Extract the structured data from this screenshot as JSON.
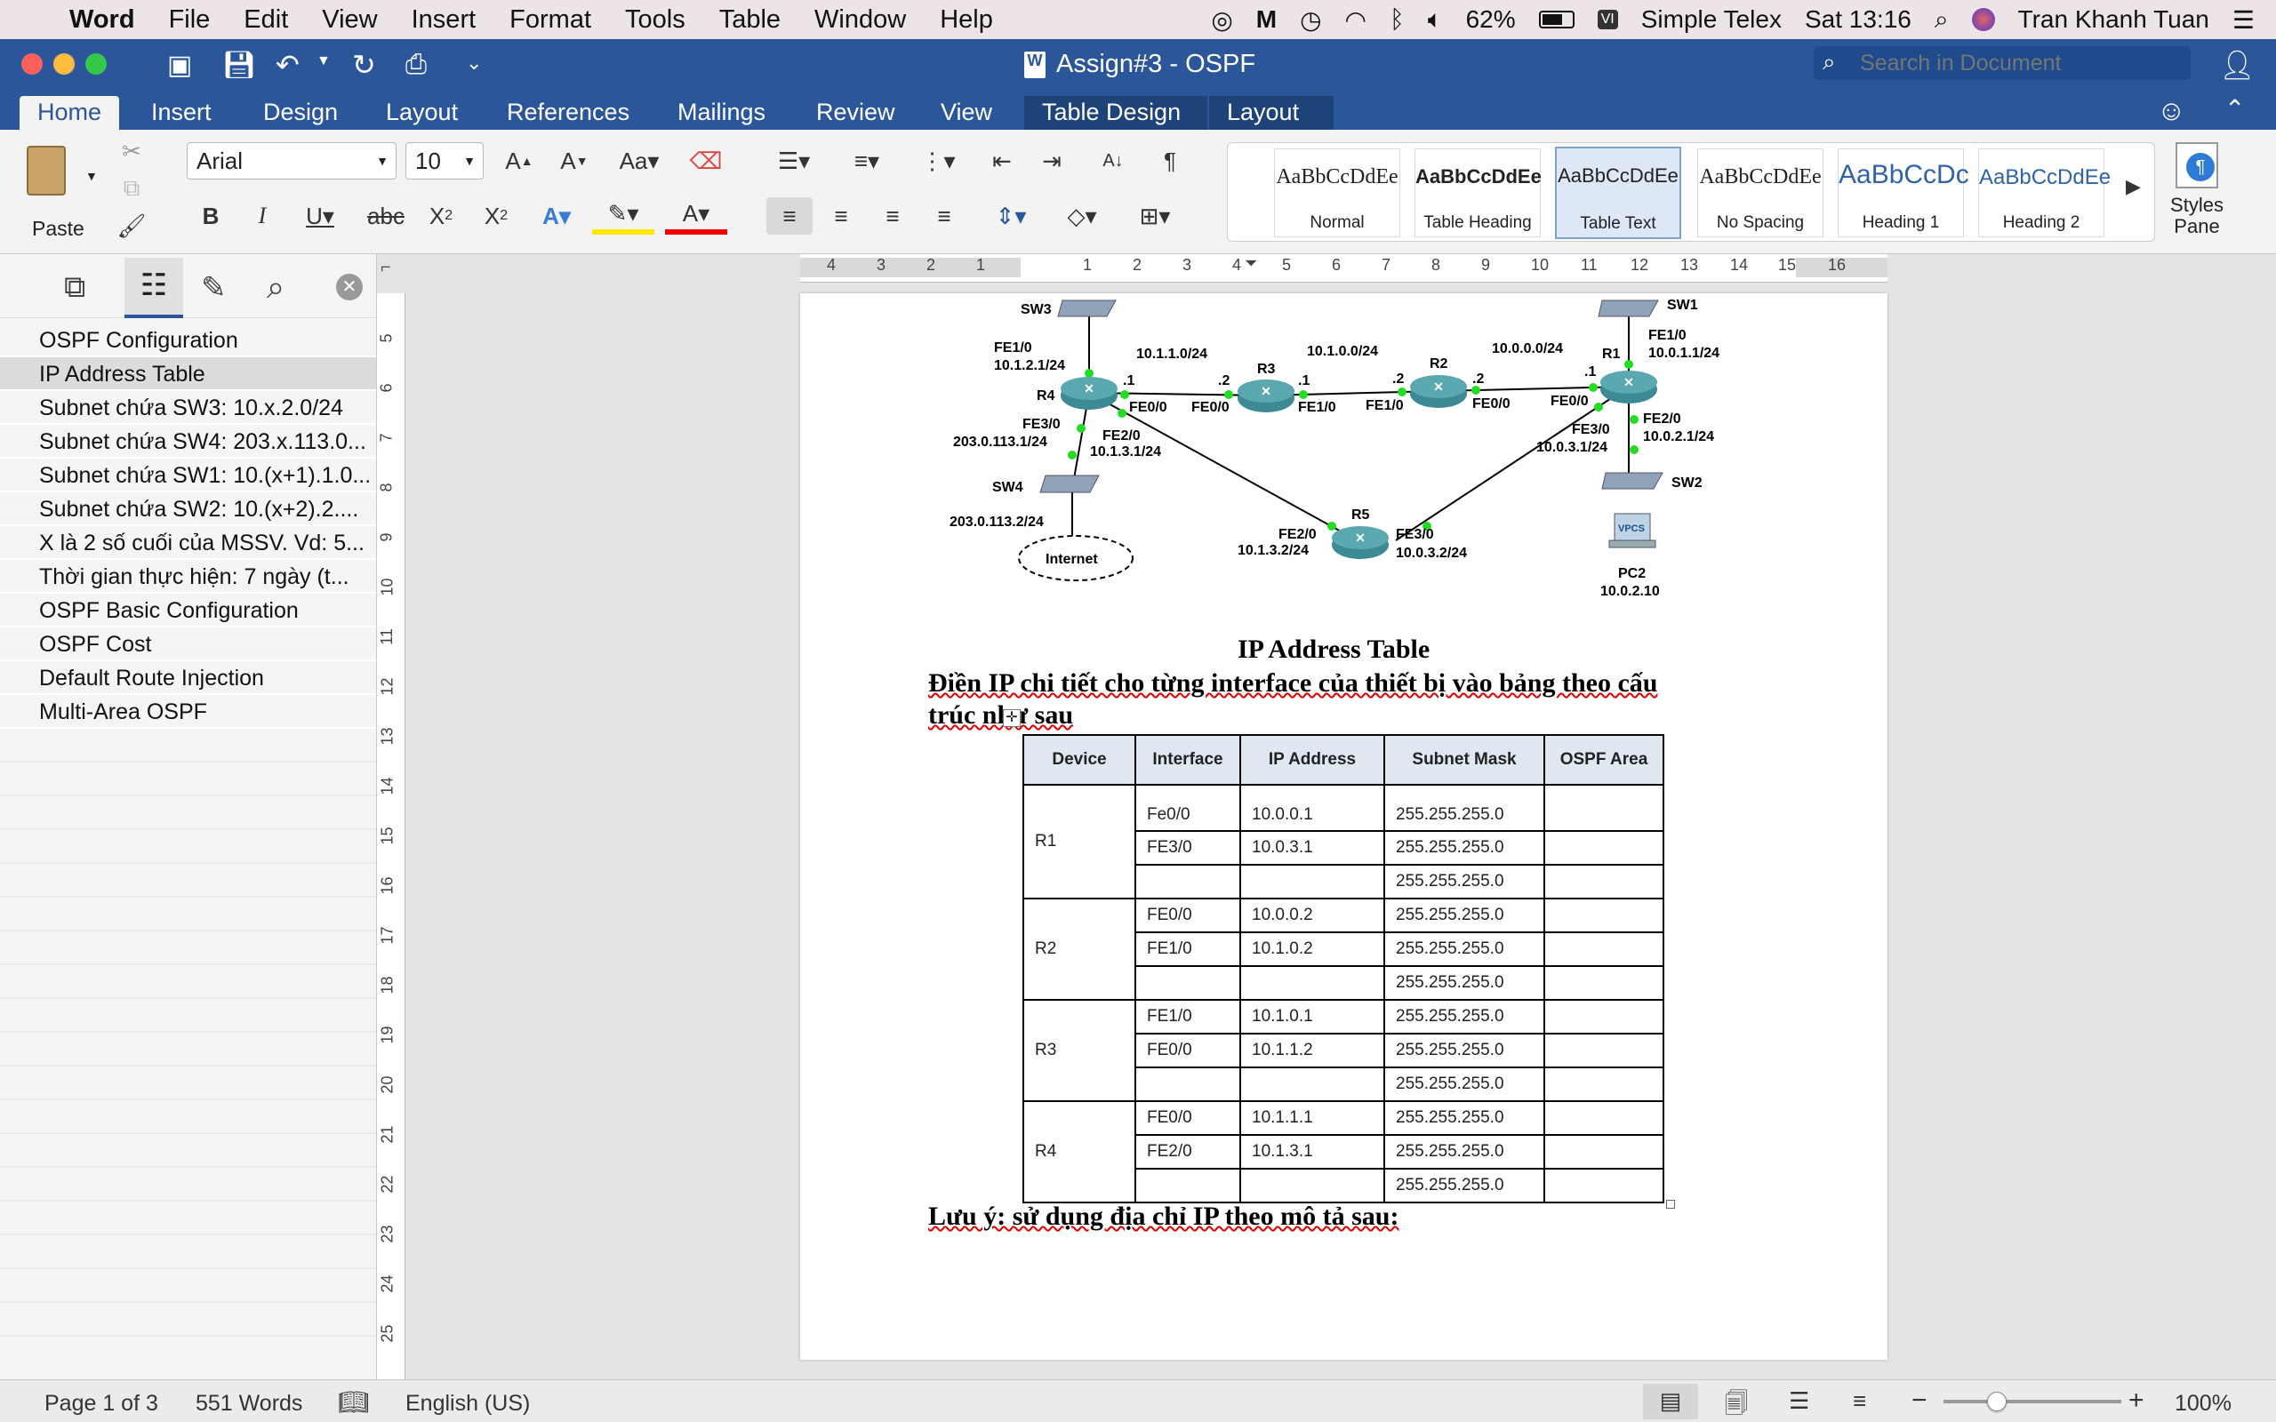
{
  "menubar": {
    "app": "Word",
    "items": [
      "File",
      "Edit",
      "View",
      "Insert",
      "Format",
      "Tools",
      "Table",
      "Window",
      "Help"
    ],
    "battery": "62%",
    "input_method": "Simple Telex",
    "clock": "Sat 13:16",
    "user": "Tran Khanh Tuan"
  },
  "window": {
    "title": "Assign#3 - OSPF",
    "search_placeholder": "Search in Document"
  },
  "ribbon_tabs": [
    "Home",
    "Insert",
    "Design",
    "Layout",
    "References",
    "Mailings",
    "Review",
    "View",
    "Table Design",
    "Layout"
  ],
  "ribbon": {
    "paste_label": "Paste",
    "font_name": "Arial",
    "font_size": "10",
    "styles": [
      {
        "preview": "AaBbCcDdEe",
        "name": "Normal"
      },
      {
        "preview": "AaBbCcDdEe",
        "name": "Table Heading"
      },
      {
        "preview": "AaBbCcDdEe",
        "name": "Table Text"
      },
      {
        "preview": "AaBbCcDdEe",
        "name": "No Spacing"
      },
      {
        "preview": "AaBbCcDc",
        "name": "Heading 1"
      },
      {
        "preview": "AaBbCcDdEe",
        "name": "Heading 2"
      }
    ],
    "styles_pane": "Styles Pane"
  },
  "nav": {
    "items": [
      "OSPF Configuration",
      "IP Address Table",
      "Subnet chứa SW3: 10.x.2.0/24",
      "Subnet chứa SW4: 203.x.113.0...",
      "Subnet chứa SW1: 10.(x+1).1.0...",
      "Subnet chứa SW2: 10.(x+2).2....",
      "X là 2 số cuối của MSSV. Vd: 5...",
      "Thời gian thực hiện: 7 ngày (t...",
      "OSPF Basic Configuration",
      "OSPF Cost",
      "Default Route Injection",
      "Multi-Area OSPF"
    ],
    "selected": 1
  },
  "ruler_h": [
    "4",
    "3",
    "2",
    "1",
    "1",
    "2",
    "3",
    "4",
    "5",
    "6",
    "7",
    "8",
    "9",
    "10",
    "11",
    "12",
    "13",
    "14",
    "15",
    "16"
  ],
  "ruler_v": [
    "5",
    "6",
    "7",
    "8",
    "9",
    "10",
    "11",
    "12",
    "13",
    "14",
    "15",
    "16",
    "17",
    "18",
    "19",
    "20",
    "21",
    "22",
    "23",
    "24",
    "25"
  ],
  "diagram": {
    "devices": [
      "SW3",
      "R4",
      "R3",
      "R2",
      "R1",
      "SW1",
      "SW4",
      "R5",
      "SW2",
      "PC2",
      "Internet",
      "VPCS"
    ],
    "labels": {
      "sw3_if": "FE1/0",
      "sw3_ip": "10.1.2.1/24",
      "net_r4_r3": "10.1.1.0/24",
      "net_r3_r2": "10.1.0.0/24",
      "net_r2_r1": "10.0.0.0/24",
      "sw1_if": "FE1/0",
      "sw1_ip": "10.0.1.1/24",
      "r4_fe00": "FE0/0",
      "r3_fe00": "FE0/0",
      "r3_fe10": "FE1/0",
      "r2_fe10": "FE1/0",
      "r2_fe00": "FE0/0",
      "r1_fe00": "FE0/0",
      "dot1a": ".1",
      "dot2a": ".2",
      "dot1b": ".1",
      "dot2b": ".2",
      "dot2c": ".2",
      "dot1c": ".1",
      "r4_fe30": "FE3/0",
      "r4_fe30_ip": "203.0.113.1/24",
      "r4_fe20": "FE2/0",
      "r4_fe20_ip": "10.1.3.1/24",
      "r1_fe30": "FE3/0",
      "r1_fe30_ip": "10.0.3.1/24",
      "r1_fe20": "FE2/0",
      "r1_fe20_ip": "10.0.2.1/24",
      "sw4_ip": "203.0.113.2/24",
      "r5_fe20": "FE2/0",
      "r5_fe20_ip": "10.1.3.2/24",
      "r5_fe30": "FE3/0",
      "r5_fe30_ip": "10.0.3.2/24",
      "pc2_ip": "10.0.2.10"
    }
  },
  "document": {
    "heading": "IP Address Table",
    "instruction_1": "Điền IP chi tiết cho từng interface của thiết bị vào bảng theo cấu",
    "instruction_2": "trúc như sau",
    "note": "Lưu ý: sử dụng địa chỉ IP theo mô tả sau:",
    "table": {
      "headers": [
        "Device",
        "Interface",
        "IP Address",
        "Subnet Mask",
        "OSPF Area"
      ],
      "groups": [
        {
          "device": "R1",
          "rows": [
            [
              "Fe0/0",
              "10.0.0.1",
              "255.255.255.0",
              ""
            ],
            [
              "FE3/0",
              "10.0.3.1",
              "255.255.255.0",
              ""
            ],
            [
              "",
              "",
              "255.255.255.0",
              ""
            ]
          ]
        },
        {
          "device": "R2",
          "rows": [
            [
              "FE0/0",
              "10.0.0.2",
              "255.255.255.0",
              ""
            ],
            [
              "FE1/0",
              "10.1.0.2",
              "255.255.255.0",
              ""
            ],
            [
              "",
              "",
              "255.255.255.0",
              ""
            ]
          ]
        },
        {
          "device": "R3",
          "rows": [
            [
              "FE1/0",
              "10.1.0.1",
              "255.255.255.0",
              ""
            ],
            [
              "FE0/0",
              "10.1.1.2",
              "255.255.255.0",
              ""
            ],
            [
              "",
              "",
              "255.255.255.0",
              ""
            ]
          ]
        },
        {
          "device": "R4",
          "rows": [
            [
              "FE0/0",
              "10.1.1.1",
              "255.255.255.0",
              ""
            ],
            [
              "FE2/0",
              "10.1.3.1",
              "255.255.255.0",
              ""
            ],
            [
              "",
              "",
              "255.255.255.0",
              ""
            ]
          ]
        }
      ]
    }
  },
  "status": {
    "page": "Page 1 of 3",
    "words": "551 Words",
    "language": "English (US)",
    "zoom": "100%",
    "zoom_level": 1.0
  },
  "colors": {
    "word_blue": "#2b579a",
    "router_teal": "#3c8a93",
    "link_green": "#22dd22"
  }
}
